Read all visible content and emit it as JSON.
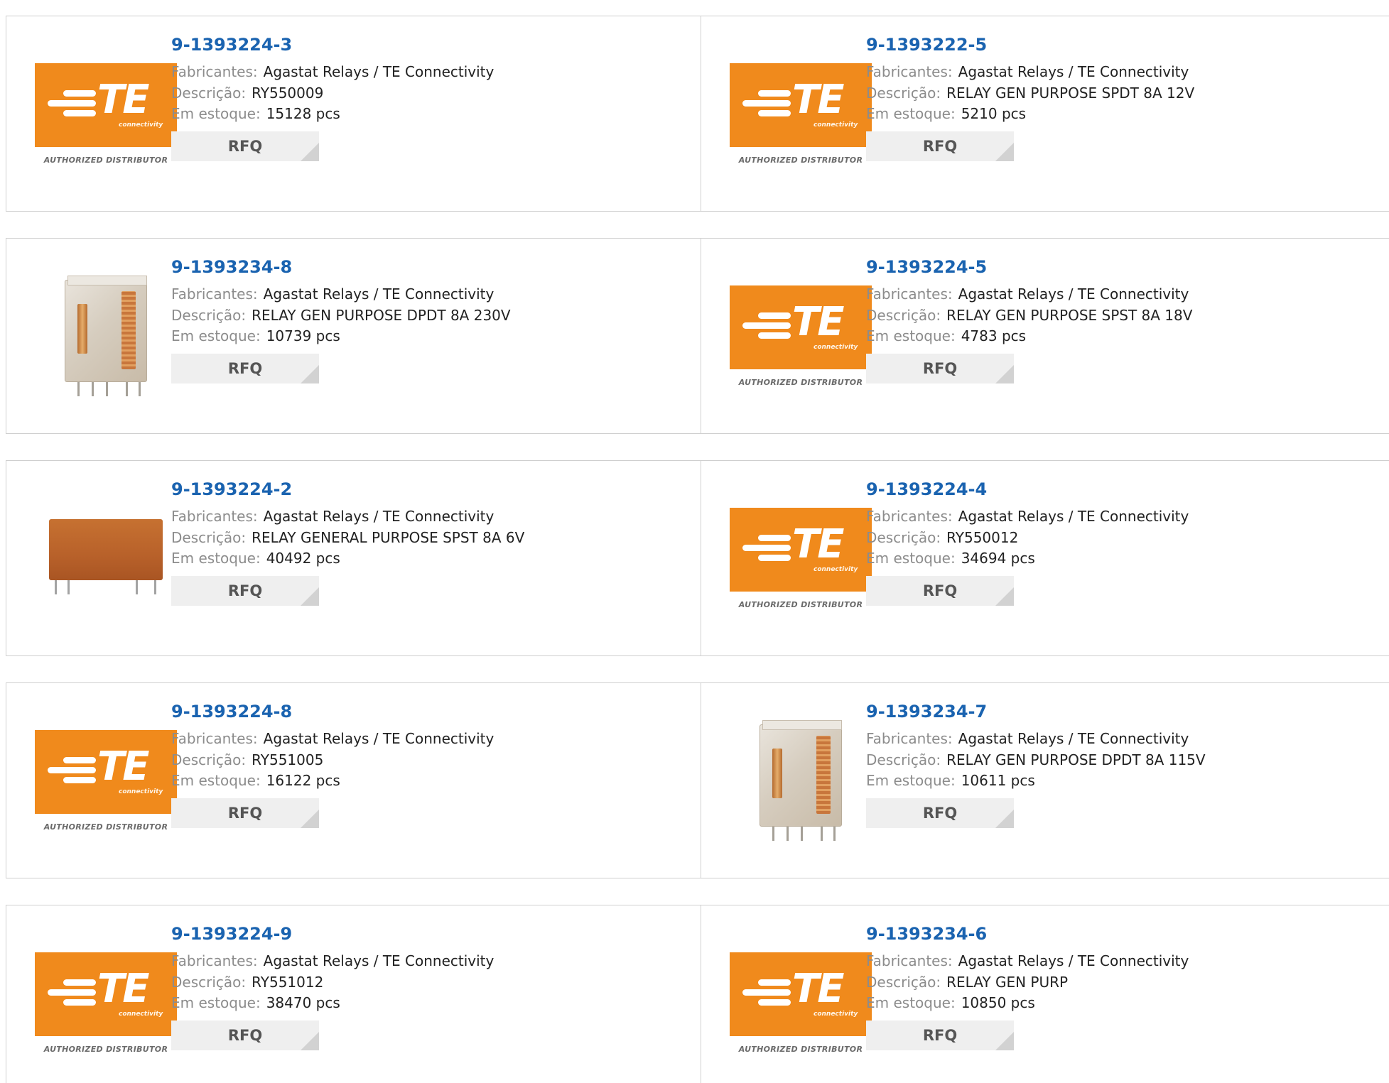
{
  "labels": {
    "manufacturer": "Fabricantes:",
    "description": "Descrição:",
    "stock": "Em estoque:",
    "rfq": "RFQ"
  },
  "logo": {
    "brand": "TE",
    "tagline": "connectivity",
    "authorized": "AUTHORIZED DISTRIBUTOR",
    "brand_color": "#f08a1c"
  },
  "products": [
    {
      "part": "9-1393224-3",
      "manufacturer": "Agastat Relays / TE Connectivity",
      "description": "RY550009",
      "stock": "15128 pcs",
      "image": "te-logo"
    },
    {
      "part": "9-1393222-5",
      "manufacturer": "Agastat Relays / TE Connectivity",
      "description": "RELAY GEN PURPOSE SPDT 8A 12V",
      "stock": "5210 pcs",
      "image": "te-logo"
    },
    {
      "part": "9-1393234-8",
      "manufacturer": "Agastat Relays / TE Connectivity",
      "description": "RELAY GEN PURPOSE DPDT 8A 230V",
      "stock": "10739 pcs",
      "image": "relay-clear"
    },
    {
      "part": "9-1393224-5",
      "manufacturer": "Agastat Relays / TE Connectivity",
      "description": "RELAY GEN PURPOSE SPST 8A 18V",
      "stock": "4783 pcs",
      "image": "te-logo"
    },
    {
      "part": "9-1393224-2",
      "manufacturer": "Agastat Relays / TE Connectivity",
      "description": "RELAY GENERAL PURPOSE SPST 8A 6V",
      "stock": "40492 pcs",
      "image": "relay-orange"
    },
    {
      "part": "9-1393224-4",
      "manufacturer": "Agastat Relays / TE Connectivity",
      "description": "RY550012",
      "stock": "34694 pcs",
      "image": "te-logo"
    },
    {
      "part": "9-1393224-8",
      "manufacturer": "Agastat Relays / TE Connectivity",
      "description": "RY551005",
      "stock": "16122 pcs",
      "image": "te-logo"
    },
    {
      "part": "9-1393234-7",
      "manufacturer": "Agastat Relays / TE Connectivity",
      "description": "RELAY GEN PURPOSE DPDT 8A 115V",
      "stock": "10611 pcs",
      "image": "relay-clear"
    },
    {
      "part": "9-1393224-9",
      "manufacturer": "Agastat Relays / TE Connectivity",
      "description": "RY551012",
      "stock": "38470 pcs",
      "image": "te-logo"
    },
    {
      "part": "9-1393234-6",
      "manufacturer": "Agastat Relays / TE Connectivity",
      "description": "RELAY GEN PURP",
      "stock": "10850 pcs",
      "image": "te-logo"
    }
  ]
}
